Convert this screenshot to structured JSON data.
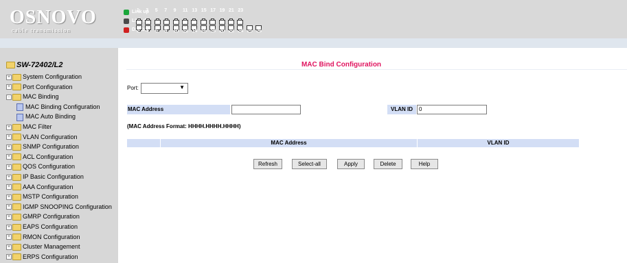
{
  "header": {
    "brand": "OSNOVO",
    "tagline": "cable transmission",
    "legend": [
      {
        "label": "Link up",
        "color": "#1aa63a"
      },
      {
        "label": "Link dn",
        "color": "#4a4a4a"
      },
      {
        "label": "Disable",
        "color": "#d02020"
      }
    ],
    "port_numbers_top": [
      "1",
      "3",
      "5",
      "7",
      "9",
      "11",
      "13",
      "15",
      "17",
      "19",
      "21",
      "23"
    ],
    "port_numbers_bottom": [
      "2",
      "4",
      "6",
      "8",
      "10",
      "12",
      "14",
      "16",
      "18",
      "20",
      "22",
      "24",
      "25",
      "26"
    ]
  },
  "sidebar": {
    "root": "SW-72402/L2",
    "items": [
      {
        "label": "System Configuration",
        "type": "folder",
        "indent": 0,
        "expand": "+"
      },
      {
        "label": "Port Configuration",
        "type": "folder",
        "indent": 0,
        "expand": "+"
      },
      {
        "label": "MAC Binding",
        "type": "open-folder",
        "indent": 0,
        "expand": "-"
      },
      {
        "label": "MAC Binding Configuration",
        "type": "doc",
        "indent": 1,
        "expand": ""
      },
      {
        "label": "MAC Auto Binding",
        "type": "doc",
        "indent": 1,
        "expand": ""
      },
      {
        "label": "MAC Filter",
        "type": "folder",
        "indent": 0,
        "expand": "+"
      },
      {
        "label": "VLAN Configuration",
        "type": "folder",
        "indent": 0,
        "expand": "+"
      },
      {
        "label": "SNMP Configuration",
        "type": "folder",
        "indent": 0,
        "expand": "+"
      },
      {
        "label": "ACL Configuration",
        "type": "folder",
        "indent": 0,
        "expand": "+"
      },
      {
        "label": "QOS Configuration",
        "type": "folder",
        "indent": 0,
        "expand": "+"
      },
      {
        "label": "IP Basic Configuration",
        "type": "folder",
        "indent": 0,
        "expand": "+"
      },
      {
        "label": "AAA Configuration",
        "type": "folder",
        "indent": 0,
        "expand": "+"
      },
      {
        "label": "MSTP Configuration",
        "type": "folder",
        "indent": 0,
        "expand": "+"
      },
      {
        "label": "IGMP SNOOPING Configuration",
        "type": "folder",
        "indent": 0,
        "expand": "+"
      },
      {
        "label": "GMRP Configuration",
        "type": "folder",
        "indent": 0,
        "expand": "+"
      },
      {
        "label": "EAPS Configuration",
        "type": "folder",
        "indent": 0,
        "expand": "+"
      },
      {
        "label": "RMON Configuration",
        "type": "folder",
        "indent": 0,
        "expand": "+"
      },
      {
        "label": "Cluster Management",
        "type": "folder",
        "indent": 0,
        "expand": "+"
      },
      {
        "label": "ERPS Configuration",
        "type": "folder",
        "indent": 0,
        "expand": "+"
      }
    ]
  },
  "main": {
    "title": "MAC Bind Configuration",
    "port_label": "Port:",
    "port_value": "",
    "mac_label": "MAC Address",
    "mac_value": "",
    "vlan_label": "VLAN ID",
    "vlan_value": "0",
    "format_note": "(MAC Address Format: HHHH.HHHH.HHHH)",
    "table_headers": [
      "",
      "MAC Address",
      "VLAN ID"
    ],
    "buttons": [
      "Refresh",
      "Select-all",
      "Apply",
      "Delete",
      "Help"
    ]
  },
  "colors": {
    "title": "#e0145f",
    "header_bg": "#d9d9d9",
    "sidebar_bg": "#d7d7d7",
    "label_bg": "#d3def5"
  }
}
